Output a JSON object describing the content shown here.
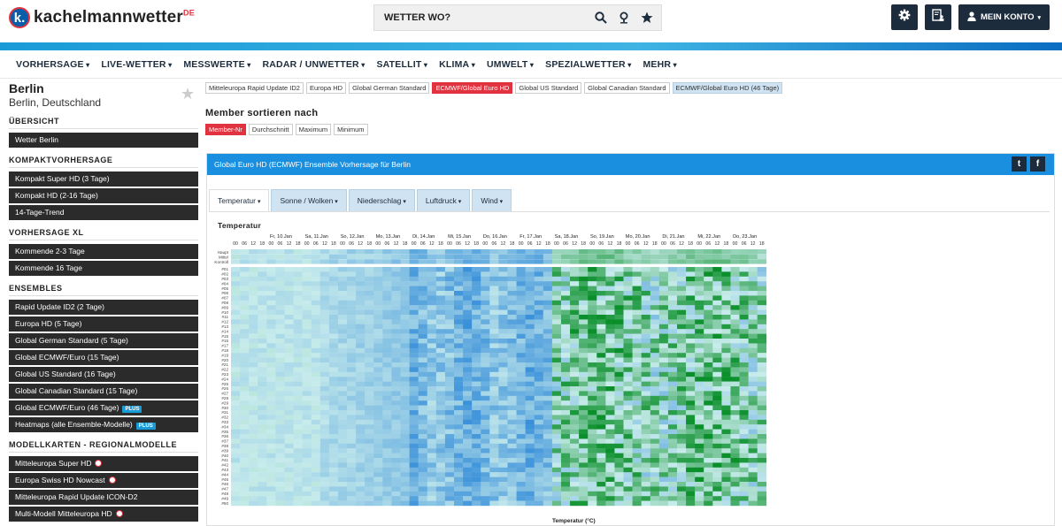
{
  "header": {
    "logo_letter": "k.",
    "logo_text": "kachelmannwetter",
    "logo_suffix": "DE",
    "search_placeholder": "WETTER WO?",
    "account_label": "MEIN KONTO"
  },
  "nav": [
    "VORHERSAGE",
    "LIVE-WETTER",
    "MESSWERTE",
    "RADAR / UNWETTER",
    "SATELLIT",
    "KLIMA",
    "UMWELT",
    "SPEZIALWETTER",
    "MEHR"
  ],
  "location": {
    "city": "Berlin",
    "region": "Berlin, Deutschland"
  },
  "sidebar": {
    "sections": [
      {
        "title": "ÜBERSICHT",
        "items": [
          {
            "label": "Wetter Berlin"
          }
        ]
      },
      {
        "title": "KOMPAKTVORHERSAGE",
        "items": [
          {
            "label": "Kompakt Super HD (3 Tage)"
          },
          {
            "label": "Kompakt HD (2-16 Tage)"
          },
          {
            "label": "14-Tage-Trend"
          }
        ]
      },
      {
        "title": "VORHERSAGE XL",
        "items": [
          {
            "label": "Kommende 2-3 Tage"
          },
          {
            "label": "Kommende 16 Tage"
          }
        ]
      },
      {
        "title": "ENSEMBLES",
        "items": [
          {
            "label": "Rapid Update ID2 (2 Tage)"
          },
          {
            "label": "Europa HD (5 Tage)"
          },
          {
            "label": "Global German Standard (5 Tage)"
          },
          {
            "label": "Global ECMWF/Euro (15 Tage)"
          },
          {
            "label": "Global US Standard (16 Tage)"
          },
          {
            "label": "Global Canadian Standard (15 Tage)"
          },
          {
            "label": "Global ECMWF/Euro (46 Tage)",
            "badge": "PLUS"
          },
          {
            "label": "Heatmaps (alle Ensemble-Modelle)",
            "badge": "PLUS"
          }
        ]
      },
      {
        "title": "MODELLKARTEN - REGIONALMODELLE",
        "items": [
          {
            "label": "Mitteleuropa Super HD",
            "icon": true
          },
          {
            "label": "Europa Swiss HD Nowcast",
            "icon": true
          },
          {
            "label": "Mitteleuropa Rapid Update ICON-D2"
          },
          {
            "label": "Multi-Modell Mitteleuropa HD",
            "icon": true
          }
        ]
      }
    ]
  },
  "model_tabs": [
    {
      "label": "Mitteleuropa Rapid Update ID2",
      "state": ""
    },
    {
      "label": "Europa HD",
      "state": ""
    },
    {
      "label": "Global German Standard",
      "state": ""
    },
    {
      "label": "ECMWF/Global Euro HD",
      "state": "active"
    },
    {
      "label": "Global US Standard",
      "state": ""
    },
    {
      "label": "Global Canadian Standard",
      "state": ""
    },
    {
      "label": "ECMWF/Global Euro HD (46 Tage)",
      "state": "sel"
    }
  ],
  "sort": {
    "title": "Member sortieren nach",
    "options": [
      {
        "label": "Member-Nr",
        "active": true
      },
      {
        "label": "Durchschnitt",
        "active": false
      },
      {
        "label": "Maximum",
        "active": false
      },
      {
        "label": "Minimum",
        "active": false
      }
    ]
  },
  "panel": {
    "title": "Global Euro HD (ECMWF) Ensemble Vorhersage für Berlin",
    "tabs": [
      "Temperatur",
      "Sonne / Wolken",
      "Niederschlag",
      "Luftdruck",
      "Wind"
    ],
    "active_tab": 0,
    "heatmap_title": "Temperatur",
    "footer_label": "Temperatur (°C)"
  },
  "chart_data": {
    "type": "heatmap",
    "title": "Temperatur",
    "xlabel": "Temperatur (°C)",
    "days": [
      "Fr, 10.Jan",
      "Sa, 11.Jan",
      "So, 12.Jan",
      "Mo, 13.Jan",
      "Di, 14.Jan",
      "Mi, 15.Jan",
      "Do, 16.Jan",
      "Fr, 17.Jan",
      "Sa, 18.Jan",
      "So, 19.Jan",
      "Mo, 20.Jan",
      "Di, 21.Jan",
      "Mi, 22.Jan",
      "Do, 23.Jan"
    ],
    "hours": [
      "00",
      "06",
      "12",
      "18"
    ],
    "control_rows": [
      "Haupt",
      "Mittel",
      "Kontroll"
    ],
    "members": 50,
    "colors": {
      "cold": "#1f7fd6",
      "mid": "#c8ecec",
      "warm": "#0a8f2a"
    }
  }
}
